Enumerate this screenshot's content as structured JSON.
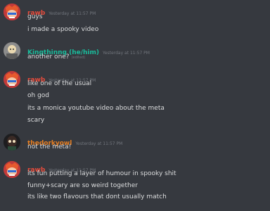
{
  "colors": {
    "background": "#36393f",
    "rawb": "#e74c3c",
    "kingthinng": "#1abc9c",
    "thedorkyowl": "#e67e22",
    "timestamp": "#72767d",
    "text": "#dcddde"
  },
  "messages": [
    {
      "author": "rawb",
      "timestamp": "Yesterday at 11:57 PM",
      "avatar_icon": "rawb-avatar",
      "lines": [
        "guys",
        "i made a spooky video"
      ]
    },
    {
      "author": "Kingthinng (he/him)",
      "timestamp": "Yesterday at 11:57 PM",
      "avatar_icon": "kingthinng-avatar",
      "lines": [
        "another one?"
      ],
      "edited_tag": "(edited)"
    },
    {
      "author": "rawb",
      "timestamp": "Yesterday at 11:57 PM",
      "avatar_icon": "rawb-avatar",
      "lines": [
        "like one of the usual",
        "oh god",
        "its a monica youtube video about the meta",
        "scary"
      ]
    },
    {
      "author": "thedorkyowl",
      "timestamp": "Yesterday at 11:57 PM",
      "avatar_icon": "thedorkyowl-avatar",
      "lines": [
        "not the meta!"
      ]
    },
    {
      "author": "rawb",
      "timestamp": "Yesterday at 11:57 PM",
      "avatar_icon": "rawb-avatar",
      "lines": [
        "its fun putting a layer of humour in spooky shit",
        "funny+scary are so weird together",
        "its like two flavours that dont usually match"
      ]
    }
  ]
}
